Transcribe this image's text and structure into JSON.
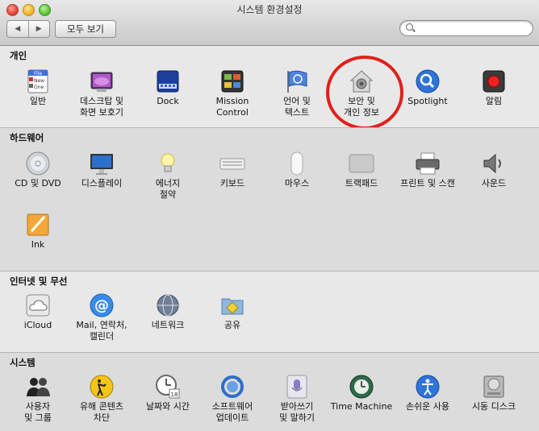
{
  "window": {
    "title": "시스템 환경설정"
  },
  "toolbar": {
    "back": "◀",
    "forward": "▶",
    "show_all": "모두 보기",
    "search_value": "",
    "search_placeholder": ""
  },
  "sections": {
    "personal": {
      "title": "개인"
    },
    "hardware": {
      "title": "하드웨어"
    },
    "internet": {
      "title": "인터넷 및 무선"
    },
    "system": {
      "title": "시스템"
    }
  },
  "panes": {
    "general": "일반",
    "desktop": "데스크탑 및\n화면 보호기",
    "dock": "Dock",
    "mission": "Mission\nControl",
    "language": "언어 및\n텍스트",
    "security": "보안 및\n개인 정보",
    "spotlight": "Spotlight",
    "notifications": "알림",
    "cddvd": "CD 및 DVD",
    "displays": "디스플레이",
    "energy": "에너지\n절약",
    "keyboard": "키보드",
    "mouse": "마우스",
    "trackpad": "트랙패드",
    "printers": "프린트 및 스캔",
    "sound": "사운드",
    "ink": "Ink",
    "icloud": "iCloud",
    "mail": "Mail, 연락처,\n캘린더",
    "network": "네트워크",
    "sharing": "공유",
    "users": "사용자\n및 그룹",
    "parental": "유해 콘텐츠\n차단",
    "datetime": "날짜와 시간",
    "update": "소프트웨어\n업데이트",
    "dictation": "받아쓰기\n및 말하기",
    "timemachine": "Time Machine",
    "accessibility": "손쉬운 사용",
    "startup": "시동 디스크"
  },
  "icon_text": {
    "general_lines": [
      "File",
      "New",
      "One"
    ],
    "datetime_day": "18"
  },
  "colors": {
    "highlight_ring": "#e1201b"
  }
}
